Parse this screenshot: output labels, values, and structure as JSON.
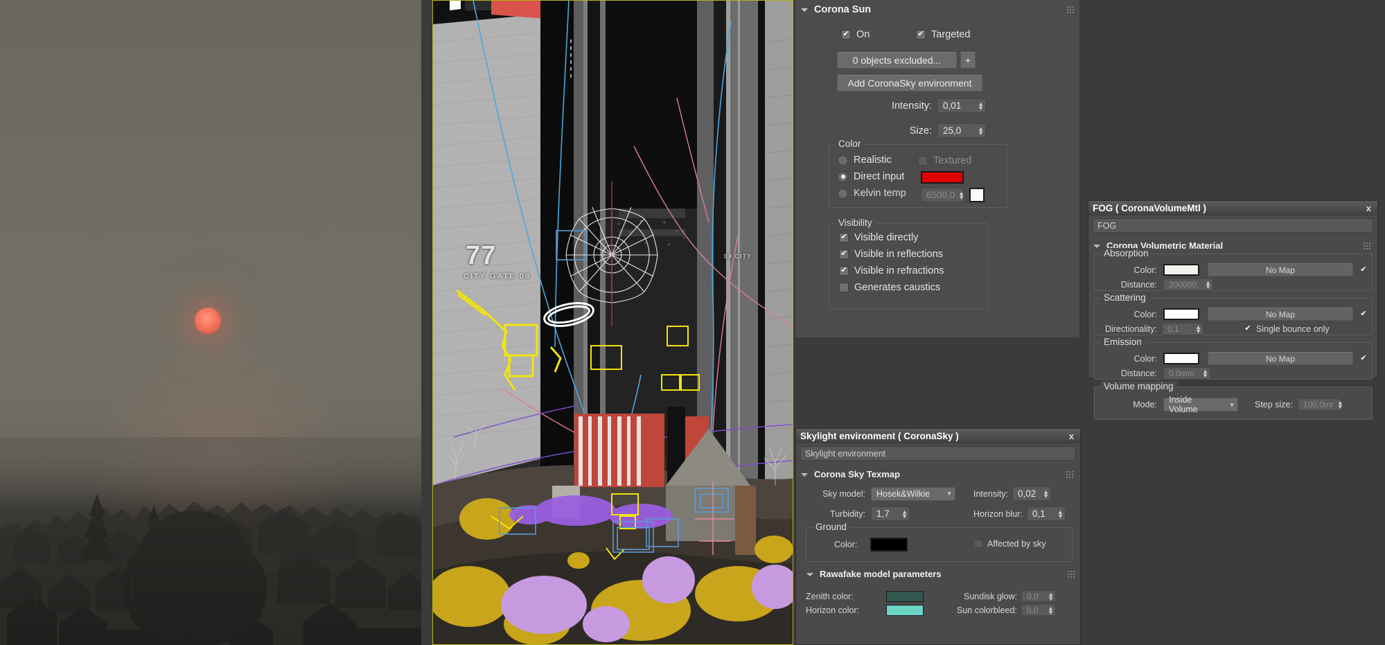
{
  "viewport": {
    "overlay_number": "77",
    "overlay_caption": "CITY GATE 08",
    "overlay_caption_right": "08 CITY"
  },
  "corona_sun": {
    "rollout_title": "Corona Sun",
    "on_label": "On",
    "on_checked": true,
    "targeted_label": "Targeted",
    "targeted_checked": true,
    "exclude_button": "0 objects excluded...",
    "add_button": "+",
    "add_sky_button": "Add CoronaSky environment",
    "intensity_label": "Intensity:",
    "intensity_value": "0,01",
    "size_label": "Size:",
    "size_value": "25,0",
    "color_group": "Color",
    "realistic_label": "Realistic",
    "realistic_selected": false,
    "textured_label": "Textured",
    "textured_checked": false,
    "direct_input_label": "Direct input",
    "direct_input_selected": true,
    "direct_input_color": "#e00000",
    "kelvin_label": "Kelvin temp",
    "kelvin_value": "6500,0",
    "kelvin_color": "#fbfbfb",
    "visibility_group": "Visibility",
    "visible_directly": "Visible directly",
    "visible_directly_checked": true,
    "visible_reflections": "Visible in reflections",
    "visible_reflections_checked": true,
    "visible_refractions": "Visible in refractions",
    "visible_refractions_checked": true,
    "generates_caustics": "Generates caustics",
    "generates_caustics_checked": false
  },
  "skylight": {
    "window_title": "Skylight environment  ( CoronaSky )",
    "close_label": "x",
    "name_field": "Skylight environment",
    "texmap_rollout": "Corona Sky Texmap",
    "sky_model_label": "Sky model:",
    "sky_model_value": "Hosek&Wilkie",
    "intensity_label": "Intensity:",
    "intensity_value": "0,02",
    "turbidity_label": "Turbidity:",
    "turbidity_value": "1,7",
    "horizon_blur_label": "Horizon blur:",
    "horizon_blur_value": "0,1",
    "ground_group": "Ground",
    "ground_color_label": "Color:",
    "ground_color": "#000000",
    "affected_by_sky_label": "Affected by sky",
    "affected_by_sky_checked": false,
    "rawafake_rollout": "Rawafake model parameters",
    "zenith_color_label": "Zenith color:",
    "zenith_color": "#31574f",
    "horizon_color_label": "Horizon color:",
    "horizon_color": "#6ad4c4",
    "sundisk_glow_label": "Sundisk glow:",
    "sundisk_glow_value": "0,0",
    "sun_colorbleed_label": "Sun colorbleed:",
    "sun_colorbleed_value": "0,0"
  },
  "fog": {
    "window_title": "FOG  ( CoronaVolumeMtl )",
    "close_label": "x",
    "name_field": "FOG",
    "rollout_title": "Corona Volumetric Material",
    "absorption_group": "Absorption",
    "absorption_color_label": "Color:",
    "absorption_color": "#f2f2ef",
    "absorption_map": "No Map",
    "absorption_map_checked": true,
    "absorption_distance_label": "Distance:",
    "absorption_distance_value": "200000,",
    "scattering_group": "Scattering",
    "scattering_color_label": "Color:",
    "scattering_color": "#ffffff",
    "scattering_map": "No Map",
    "scattering_map_checked": true,
    "directionality_label": "Directionality:",
    "directionality_value": "0,1",
    "single_bounce_label": "Single bounce only",
    "single_bounce_checked": true,
    "emission_group": "Emission",
    "emission_color_label": "Color:",
    "emission_color": "#ffffff",
    "emission_map": "No Map",
    "emission_map_checked": true,
    "emission_distance_label": "Distance:",
    "emission_distance_value": "0,0mm",
    "volume_mapping_group": "Volume mapping",
    "mode_label": "Mode:",
    "mode_value": "Inside Volume",
    "step_size_label": "Step size:",
    "step_size_value": "100,0mr"
  }
}
